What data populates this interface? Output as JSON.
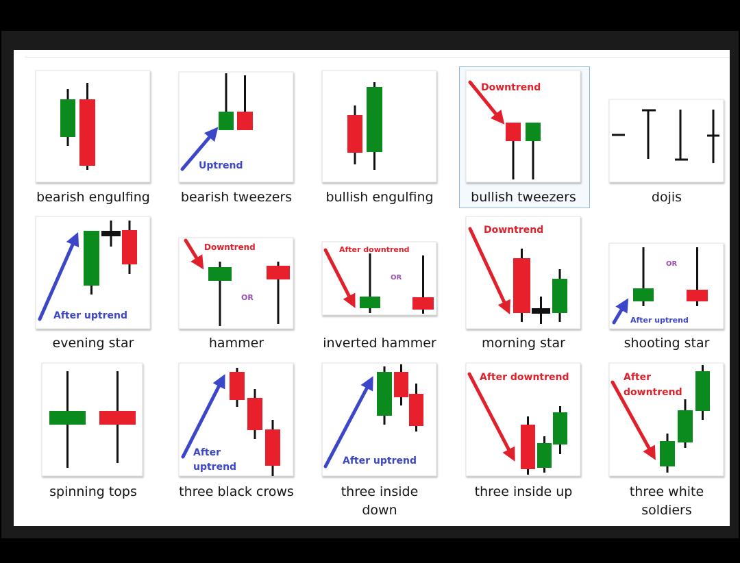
{
  "colors": {
    "bull": "#0b8a1e",
    "bear": "#e8202b",
    "doji": "#111111",
    "up_arrow": "#3b46c8",
    "down_arrow": "#e0202a",
    "or_text": "#9a4fb2",
    "selection": "#8fb3dc"
  },
  "items": [
    {
      "label": "bearish engulfing"
    },
    {
      "label": "bearish tweezers",
      "annotation": "Uptrend"
    },
    {
      "label": "bullish engulfing"
    },
    {
      "label": "bullish tweezers",
      "annotation": "Downtrend",
      "selected": true
    },
    {
      "label": "dojis"
    },
    {
      "label": "evening star",
      "annotation": "After uptrend"
    },
    {
      "label": "hammer",
      "annotation": "Downtrend",
      "or": "OR"
    },
    {
      "label": "inverted hammer",
      "annotation": "After downtrend",
      "or": "OR"
    },
    {
      "label": "morning star",
      "annotation": "Downtrend"
    },
    {
      "label": "shooting star",
      "annotation": "After uptrend",
      "or": "OR"
    },
    {
      "label": "spinning tops"
    },
    {
      "label": "three black crows",
      "annotation_lines": [
        "After",
        "uptrend"
      ]
    },
    {
      "label_lines": [
        "three inside",
        "down"
      ],
      "annotation": "After uptrend"
    },
    {
      "label": "three inside up",
      "annotation": "After downtrend"
    },
    {
      "label_lines": [
        "three white",
        "soldiers"
      ],
      "annotation_lines": [
        "After",
        "downtrend"
      ]
    }
  ]
}
